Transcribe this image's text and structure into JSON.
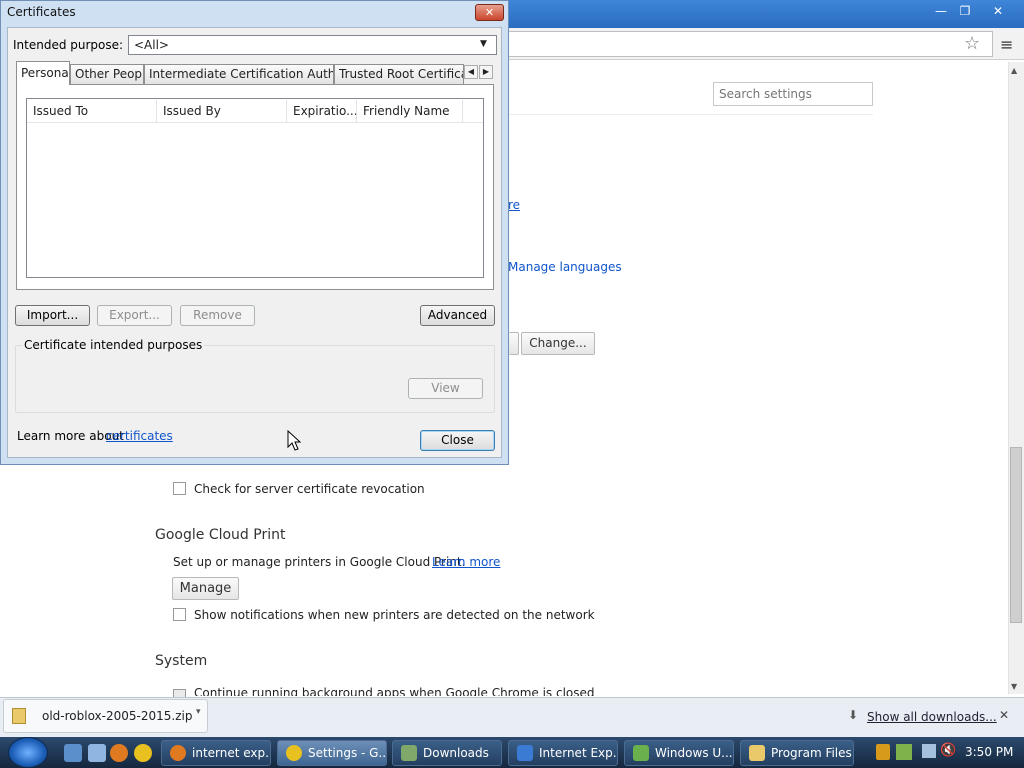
{
  "browser": {
    "window_controls": {
      "minimize": "—",
      "restore": "❐",
      "close": "✕"
    },
    "star": "☆",
    "menu": "≡"
  },
  "settings": {
    "search_placeholder": "Search settings",
    "partial_link_1": "re",
    "manage_languages": "Manage languages",
    "change_button": "Change...",
    "check_revocation": "Check for server certificate revocation",
    "cloud_print_heading": "Google Cloud Print",
    "cloud_print_desc": "Set up or manage printers in Google Cloud Print.",
    "learn_more": "Learn more",
    "manage_button": "Manage",
    "show_notifications": "Show notifications when new printers are detected on the network",
    "system_heading": "System",
    "background_apps": "Continue running background apps when Google Chrome is closed"
  },
  "downloads": {
    "file_name": "old-roblox-2005-2015.zip",
    "show_all": "Show all downloads...",
    "close": "✕"
  },
  "taskbar": {
    "tasks": [
      {
        "label": "internet exp...",
        "color": "#e07a20"
      },
      {
        "label": "Settings - G...",
        "color": "#e8c020"
      },
      {
        "label": "Downloads",
        "color": "#7fa86a"
      },
      {
        "label": "Internet Exp...",
        "color": "#3b7bd4"
      },
      {
        "label": "Windows U...",
        "color": "#6ab04c"
      },
      {
        "label": "Program Files",
        "color": "#e9c96a"
      }
    ],
    "clock": "3:50 PM"
  },
  "dialog": {
    "title": "Certificates",
    "close": "✕",
    "intended_purpose_label": "Intended purpose:",
    "intended_purpose_value": "<All>",
    "tabs": [
      "Personal",
      "Other People",
      "Intermediate Certification Authorities",
      "Trusted Root Certification"
    ],
    "columns": [
      "Issued To",
      "Issued By",
      "Expiratio...",
      "Friendly Name"
    ],
    "buttons": {
      "import": "Import...",
      "export": "Export...",
      "remove": "Remove",
      "advanced": "Advanced",
      "view": "View",
      "close": "Close"
    },
    "group_title": "Certificate intended purposes",
    "learn_more_prefix": "Learn more about",
    "learn_more_link": "certificates"
  }
}
